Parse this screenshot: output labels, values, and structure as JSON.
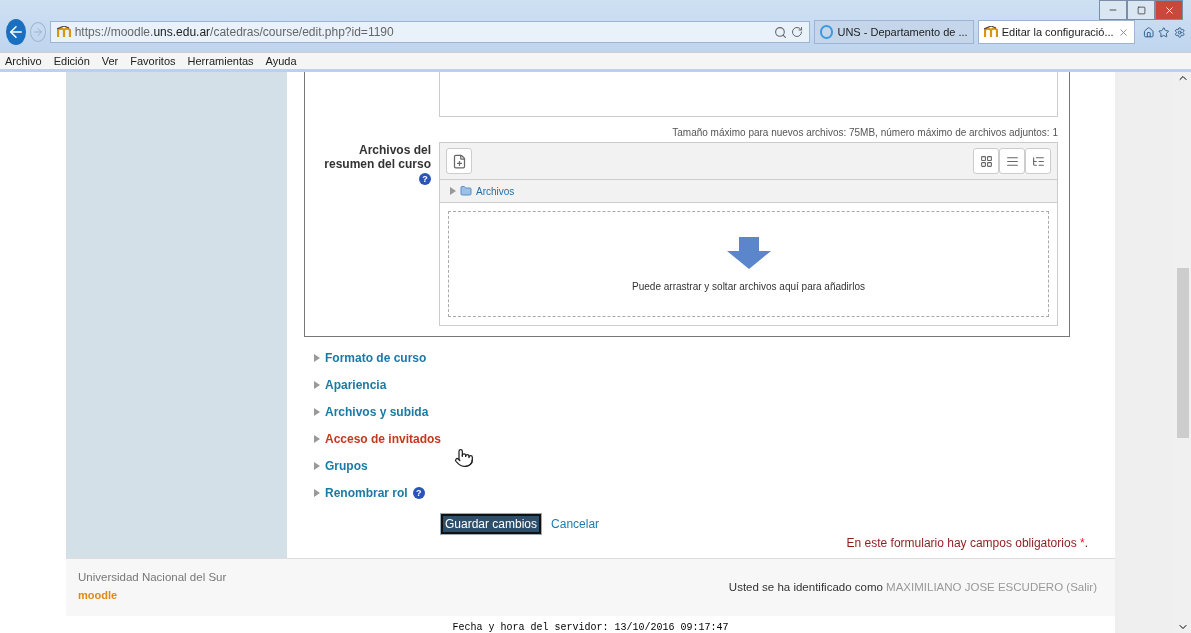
{
  "browser": {
    "address": "https://moodle.**uns.edu.ar**/catedras/course/edit.php?id=1190",
    "tabs": [
      {
        "title": "UNS - Departamento de ...",
        "selected": false,
        "kind": "ie"
      },
      {
        "title": "Editar la configuració...",
        "selected": true,
        "kind": "moodle"
      }
    ]
  },
  "menu": [
    "Archivo",
    "Edición",
    "Ver",
    "Favoritos",
    "Herramientas",
    "Ayuda"
  ],
  "files_field": {
    "label": "Archivos del resumen del curso",
    "limits": "Tamaño máximo para nuevos archivos: 75MB, número máximo de archivos adjuntos: 1",
    "folder": "Archivos",
    "drop_hint": "Puede arrastrar y soltar archivos aquí para añadirlos"
  },
  "sections": [
    {
      "label": "Formato de curso",
      "hovered": false,
      "help": false
    },
    {
      "label": "Apariencia",
      "hovered": false,
      "help": false
    },
    {
      "label": "Archivos y subida",
      "hovered": false,
      "help": false
    },
    {
      "label": "Acceso de invitados",
      "hovered": true,
      "help": false
    },
    {
      "label": "Grupos",
      "hovered": false,
      "help": false
    },
    {
      "label": "Renombrar rol",
      "hovered": false,
      "help": true
    }
  ],
  "help_glyph": "?",
  "buttons": {
    "save": "Guardar cambios",
    "cancel": "Cancelar"
  },
  "required_note": {
    "text": "En este formulario hay campos obligatorios",
    "mark": "*",
    "end": "."
  },
  "footer": {
    "institution": "Universidad Nacional del Sur",
    "logo": "moodle",
    "login_prefix": "Usted se ha identificado como",
    "user": "MAXIMILIANO JOSE ESCUDERO",
    "logout": "(Salir)"
  },
  "server_time": "Fecha y hora del servidor: 13/10/2016 09:17:47"
}
